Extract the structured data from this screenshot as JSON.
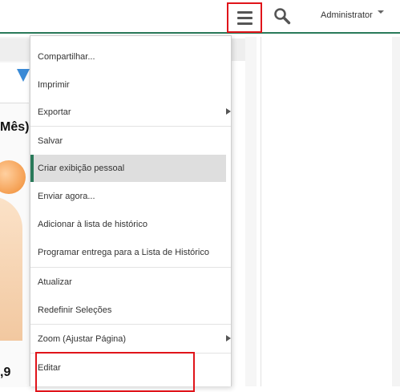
{
  "header": {
    "user_label": "Administrator"
  },
  "background": {
    "partial_title": "Mês)",
    "partial_value": ",9"
  },
  "menu": {
    "items": [
      {
        "label": "Compartilhar...",
        "has_submenu": false
      },
      {
        "label": "Imprimir",
        "has_submenu": false
      },
      {
        "label": "Exportar",
        "has_submenu": true
      },
      {
        "label": "Salvar",
        "has_submenu": false
      },
      {
        "label": "Criar exibição pessoal",
        "has_submenu": false,
        "active": true
      },
      {
        "label": "Enviar agora...",
        "has_submenu": false
      },
      {
        "label": "Adicionar à lista de histórico",
        "has_submenu": false
      },
      {
        "label": "Programar entrega para a Lista de Histórico",
        "has_submenu": false
      },
      {
        "label": "Atualizar",
        "has_submenu": false
      },
      {
        "label": "Redefinir Seleções",
        "has_submenu": false
      },
      {
        "label": "Zoom (Ajustar Página)",
        "has_submenu": true
      },
      {
        "label": "Editar",
        "has_submenu": false
      }
    ]
  },
  "icons": {
    "menu": "hamburger-menu-icon",
    "search": "search-icon",
    "user_caret": "caret-down-icon",
    "submenu": "chevron-right-icon"
  },
  "colors": {
    "accent_green": "#2a7a5a",
    "highlight_red": "#e0141a",
    "active_item_bg": "#dedede"
  }
}
